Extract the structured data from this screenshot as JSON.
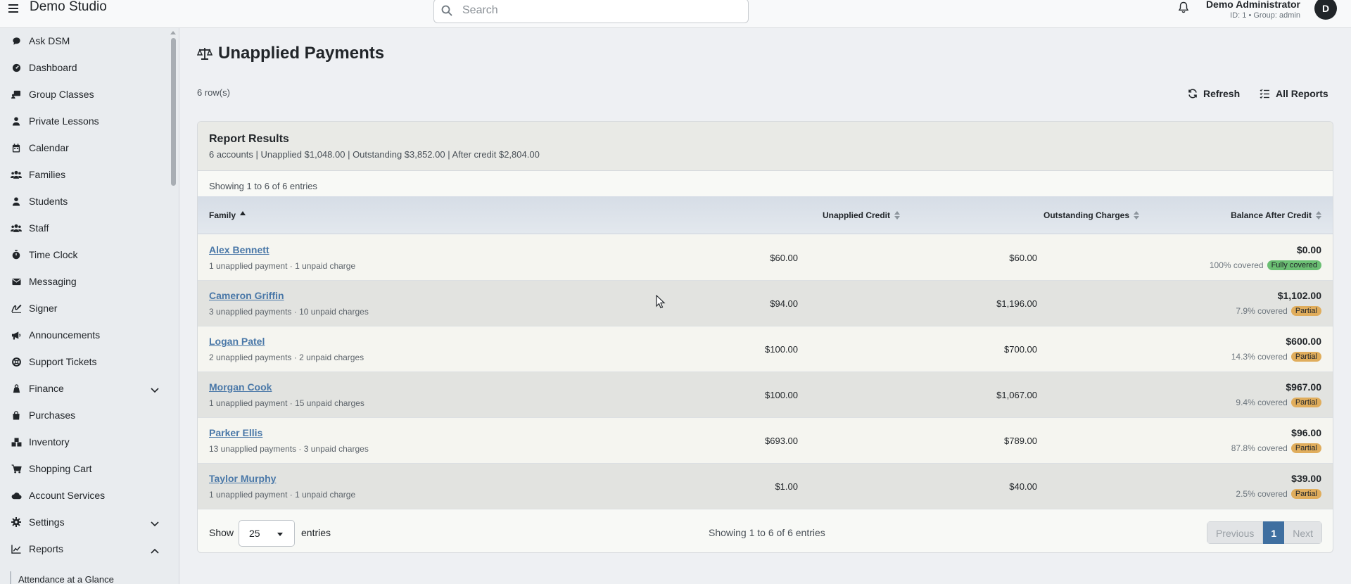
{
  "app": {
    "title": "Demo Studio"
  },
  "search": {
    "placeholder": "Search"
  },
  "user": {
    "name": "Demo Administrator",
    "meta": "ID: 1 • Group: admin",
    "initial": "D"
  },
  "sidebar": {
    "items": [
      {
        "label": "Ask DSM",
        "icon": "chat-icon"
      },
      {
        "label": "Dashboard",
        "icon": "dashboard-icon"
      },
      {
        "label": "Group Classes",
        "icon": "classes-icon"
      },
      {
        "label": "Private Lessons",
        "icon": "person-icon"
      },
      {
        "label": "Calendar",
        "icon": "calendar-icon"
      },
      {
        "label": "Families",
        "icon": "users-icon"
      },
      {
        "label": "Students",
        "icon": "person-icon"
      },
      {
        "label": "Staff",
        "icon": "users-icon"
      },
      {
        "label": "Time Clock",
        "icon": "stopwatch-icon"
      },
      {
        "label": "Messaging",
        "icon": "envelope-icon"
      },
      {
        "label": "Signer",
        "icon": "signature-icon"
      },
      {
        "label": "Announcements",
        "icon": "megaphone-icon"
      },
      {
        "label": "Support Tickets",
        "icon": "lifebuoy-icon"
      },
      {
        "label": "Finance",
        "icon": "scale-icon",
        "expandable": true,
        "expanded": false
      },
      {
        "label": "Purchases",
        "icon": "bag-icon"
      },
      {
        "label": "Inventory",
        "icon": "boxes-icon"
      },
      {
        "label": "Shopping Cart",
        "icon": "cart-icon"
      },
      {
        "label": "Account Services",
        "icon": "cloud-icon"
      },
      {
        "label": "Settings",
        "icon": "gear-icon",
        "expandable": true,
        "expanded": false
      },
      {
        "label": "Reports",
        "icon": "chart-icon",
        "expandable": true,
        "expanded": true
      }
    ],
    "sub_items": [
      "Attendance at a Glance"
    ]
  },
  "page": {
    "title": "Unapplied Payments",
    "row_count": "6 row(s)",
    "refresh_label": "Refresh",
    "all_reports_label": "All Reports"
  },
  "report": {
    "title": "Report Results",
    "summary": "6 accounts | Unapplied $1,048.00 | Outstanding $3,852.00 | After credit $2,804.00",
    "showing_top": "Showing 1 to 6 of 6 entries",
    "columns": [
      "Family",
      "Unapplied Credit",
      "Outstanding Charges",
      "Balance After Credit"
    ],
    "rows": [
      {
        "family": "Alex Bennett",
        "detail": "1 unapplied payment · 1 unpaid charge",
        "unapplied": "$60.00",
        "outstanding": "$60.00",
        "balance": "$0.00",
        "covered": "100% covered",
        "status": "Fully covered"
      },
      {
        "family": "Cameron Griffin",
        "detail": "3 unapplied payments · 10 unpaid charges",
        "unapplied": "$94.00",
        "outstanding": "$1,196.00",
        "balance": "$1,102.00",
        "covered": "7.9% covered",
        "status": "Partial"
      },
      {
        "family": "Logan Patel",
        "detail": "2 unapplied payments · 2 unpaid charges",
        "unapplied": "$100.00",
        "outstanding": "$700.00",
        "balance": "$600.00",
        "covered": "14.3% covered",
        "status": "Partial"
      },
      {
        "family": "Morgan Cook",
        "detail": "1 unapplied payment · 15 unpaid charges",
        "unapplied": "$100.00",
        "outstanding": "$1,067.00",
        "balance": "$967.00",
        "covered": "9.4% covered",
        "status": "Partial"
      },
      {
        "family": "Parker Ellis",
        "detail": "13 unapplied payments · 3 unpaid charges",
        "unapplied": "$693.00",
        "outstanding": "$789.00",
        "balance": "$96.00",
        "covered": "87.8% covered",
        "status": "Partial"
      },
      {
        "family": "Taylor Murphy",
        "detail": "1 unapplied payment · 1 unpaid charge",
        "unapplied": "$1.00",
        "outstanding": "$40.00",
        "balance": "$39.00",
        "covered": "2.5% covered",
        "status": "Partial"
      }
    ],
    "footer": {
      "show_label": "Show",
      "page_length": "25",
      "entries_label": "entries",
      "showing_bottom": "Showing 1 to 6 of 6 entries",
      "previous_label": "Previous",
      "current_page": "1",
      "next_label": "Next"
    }
  },
  "colors": {
    "accent": "#3f6fa0",
    "link": "#4a78a8",
    "badge_full": "#6bbf73",
    "badge_partial": "#e0ad5c"
  }
}
